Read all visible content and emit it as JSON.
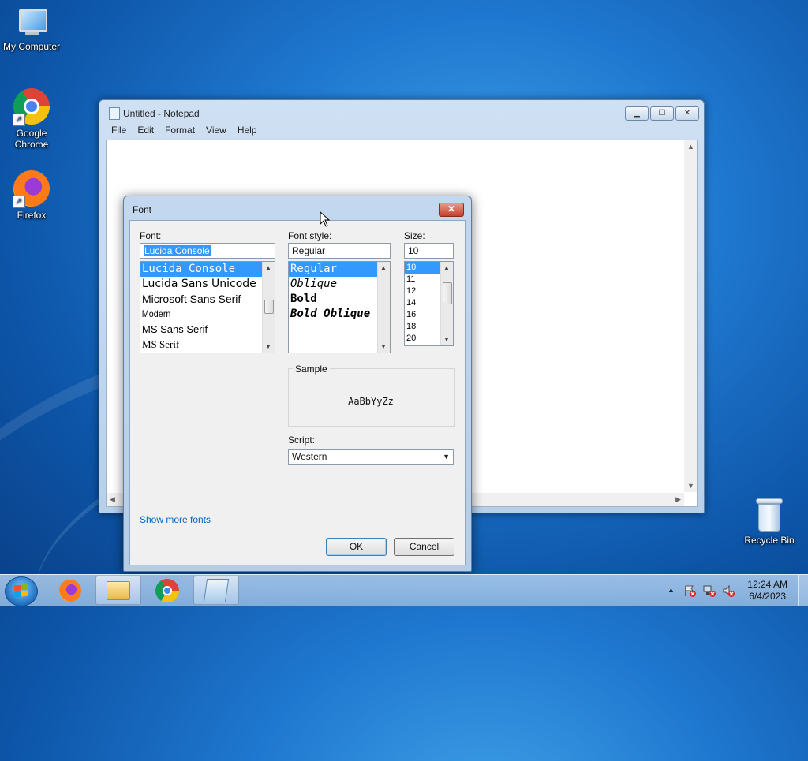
{
  "desktop": {
    "icons": [
      {
        "label": "My Computer"
      },
      {
        "label": "Google\nChrome"
      },
      {
        "label": "Firefox"
      },
      {
        "label": "Recycle Bin"
      }
    ]
  },
  "notepad": {
    "title": "Untitled - Notepad",
    "menu": [
      "File",
      "Edit",
      "Format",
      "View",
      "Help"
    ],
    "controls": {
      "minimize": "▁",
      "maximize": "☐",
      "close": "✕"
    }
  },
  "font_dialog": {
    "title": "Font",
    "close_label": "✕",
    "font_label": "Font:",
    "font_value": "Lucida Console",
    "fonts": [
      "Lucida Console",
      "Lucida Sans Unicode",
      "Microsoft Sans Serif",
      "Modern",
      "MS Sans Serif",
      "MS Serif"
    ],
    "style_label": "Font style:",
    "style_value": "Regular",
    "styles": [
      "Regular",
      "Oblique",
      "Bold",
      "Bold Oblique"
    ],
    "size_label": "Size:",
    "size_value": "10",
    "sizes": [
      "10",
      "11",
      "12",
      "14",
      "16",
      "18",
      "20"
    ],
    "sample_label": "Sample",
    "sample_text": "AaBbYyZz",
    "script_label": "Script:",
    "script_value": "Western",
    "show_more": "Show more fonts",
    "ok": "OK",
    "cancel": "Cancel"
  },
  "taskbar": {
    "time": "12:24 AM",
    "date": "6/4/2023",
    "tray_up": "▲"
  }
}
